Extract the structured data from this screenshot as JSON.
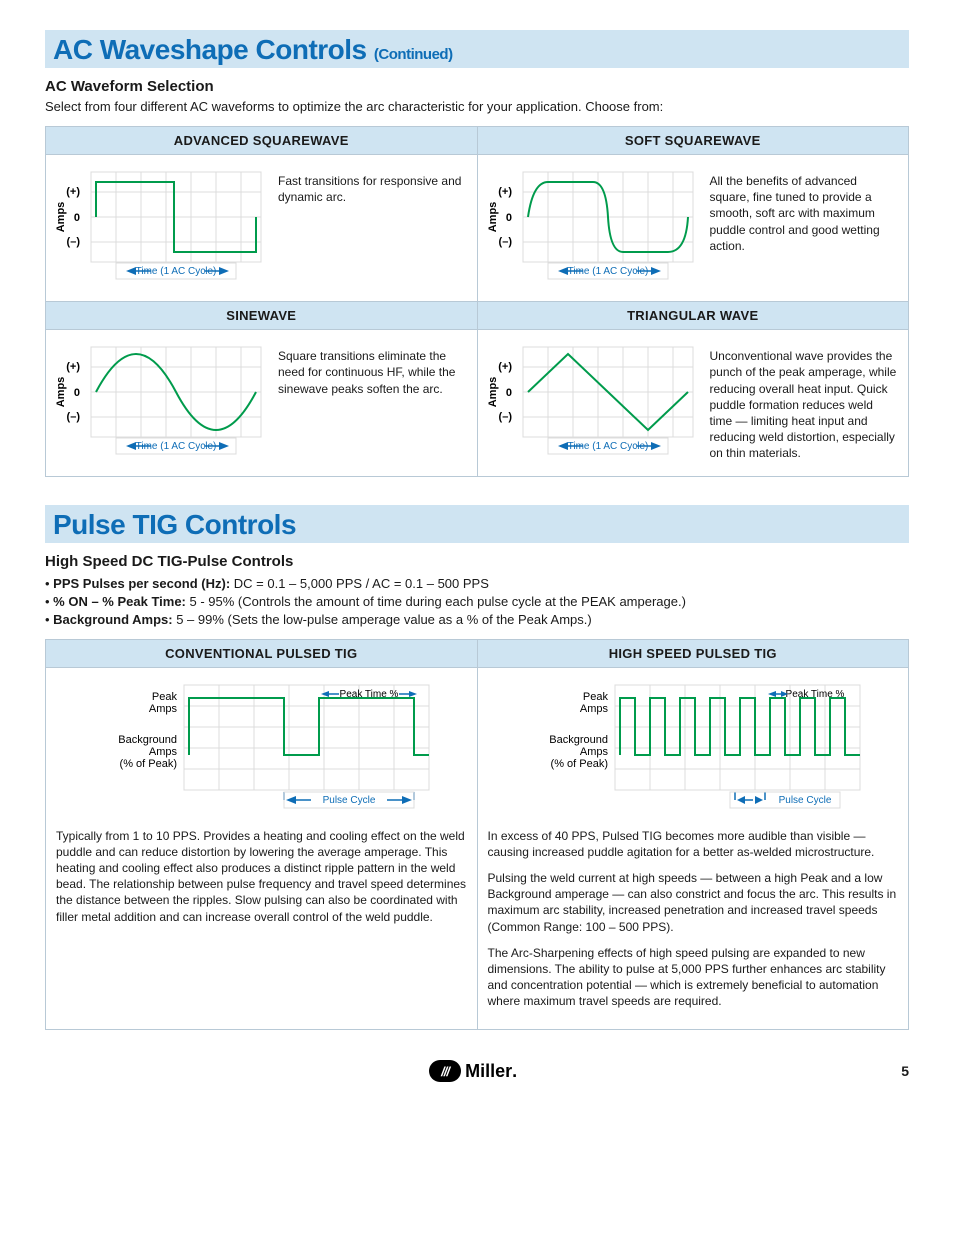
{
  "section1": {
    "title": "AC Waveshape Controls",
    "title_sub": "(Continued)",
    "heading": "AC Waveform Selection",
    "intro": "Select from four different AC waveforms to optimize the arc characteristic for your application. Choose from:",
    "waves": [
      {
        "header": "ADVANCED SQUAREWAVE",
        "y_axis": "Amps",
        "y_plus": "(+)",
        "y_zero": "0",
        "y_minus": "(–)",
        "x_axis": "Time (1 AC Cycle)",
        "desc": "Fast transitions for responsive and dynamic arc."
      },
      {
        "header": "SOFT SQUAREWAVE",
        "y_axis": "Amps",
        "y_plus": "(+)",
        "y_zero": "0",
        "y_minus": "(–)",
        "x_axis": "Time (1 AC Cycle)",
        "desc": "All the benefits of advanced square, fine tuned to provide a smooth, soft arc with maximum puddle control and good wetting action."
      },
      {
        "header": "SINEWAVE",
        "y_axis": "Amps",
        "y_plus": "(+)",
        "y_zero": "0",
        "y_minus": "(–)",
        "x_axis": "Time (1 AC Cycle)",
        "desc": "Square transitions eliminate the need for continuous HF, while the sinewave peaks soften the arc."
      },
      {
        "header": "TRIANGULAR WAVE",
        "y_axis": "Amps",
        "y_plus": "(+)",
        "y_zero": "0",
        "y_minus": "(–)",
        "x_axis": "Time (1 AC Cycle)",
        "desc": "Unconventional wave provides the punch of the peak amperage, while reducing overall heat input. Quick puddle formation reduces weld time — limiting heat input and reducing weld distortion, especially on thin materials."
      }
    ]
  },
  "section2": {
    "title": "Pulse TIG Controls",
    "heading": "High Speed DC TIG-Pulse Controls",
    "bullets": [
      {
        "label": "PPS Pulses per second (Hz):",
        "text": "  DC = 0.1 – 5,000 PPS / AC = 0.1 – 500 PPS"
      },
      {
        "label": "% ON – % Peak Time:",
        "text": "  5 - 95% (Controls the amount of time during each pulse cycle at the PEAK amperage.)"
      },
      {
        "label": "Background Amps:",
        "text": "  5 – 99% (Sets the low-pulse amperage value as a % of the Peak Amps.)"
      }
    ],
    "pulses": [
      {
        "header": "CONVENTIONAL PULSED TIG",
        "y_peak": "Peak\nAmps",
        "y_bg": "Background\nAmps\n(% of Peak)",
        "peak_time": "Peak Time %",
        "x_axis": "Pulse Cycle",
        "desc": [
          "Typically from 1 to 10 PPS. Provides a heating and cooling effect on the weld puddle and can reduce distortion by lowering the average amperage. This heating and cooling effect also produces a distinct ripple pattern in the weld bead. The relationship between pulse frequency and travel speed determines the distance between the ripples. Slow pulsing can also be coordinated with filler metal addition and can increase overall control of the weld puddle."
        ]
      },
      {
        "header": "HIGH SPEED PULSED TIG",
        "y_peak": "Peak\nAmps",
        "y_bg": "Background\nAmps\n(% of Peak)",
        "peak_time": "Peak Time %",
        "x_axis": "Pulse Cycle",
        "desc": [
          "In excess of 40 PPS, Pulsed TIG becomes more audible than visible — causing increased puddle agitation for a better as-welded microstructure.",
          "Pulsing the weld current at high speeds — between a high Peak and a low Background amperage — can also constrict and focus the arc. This results in maximum arc stability, increased penetration and increased travel speeds (Common Range: 100 – 500 PPS).",
          "The Arc-Sharpening effects of high speed pulsing are expanded to new dimensions. The ability to pulse at 5,000 PPS further enhances arc stability and concentration potential — which is extremely beneficial to automation where maximum travel speeds are required."
        ]
      }
    ]
  },
  "chart_data": [
    {
      "type": "line",
      "title": "Advanced Squarewave",
      "xlabel": "Time (1 AC Cycle)",
      "ylabel": "Amps",
      "yticks": [
        "(+)",
        "0",
        "(–)"
      ],
      "x": [
        0,
        0.05,
        0.5,
        0.55,
        1.0
      ],
      "y": [
        1,
        1,
        1,
        -1,
        -1,
        -1
      ],
      "shape": "square"
    },
    {
      "type": "line",
      "title": "Soft Squarewave",
      "xlabel": "Time (1 AC Cycle)",
      "ylabel": "Amps",
      "yticks": [
        "(+)",
        "0",
        "(–)"
      ],
      "x": [
        0,
        0.1,
        0.4,
        0.5,
        0.6,
        0.9,
        1.0
      ],
      "y": [
        0,
        1,
        1,
        0,
        -1,
        -1,
        0
      ],
      "shape": "soft-square"
    },
    {
      "type": "line",
      "title": "Sinewave",
      "xlabel": "Time (1 AC Cycle)",
      "ylabel": "Amps",
      "yticks": [
        "(+)",
        "0",
        "(–)"
      ],
      "x": [
        0,
        0.25,
        0.5,
        0.75,
        1.0
      ],
      "y": [
        0,
        1,
        0,
        -1,
        0
      ],
      "shape": "sine"
    },
    {
      "type": "line",
      "title": "Triangular Wave",
      "xlabel": "Time (1 AC Cycle)",
      "ylabel": "Amps",
      "yticks": [
        "(+)",
        "0",
        "(–)"
      ],
      "x": [
        0,
        0.25,
        0.5,
        0.75,
        1.0
      ],
      "y": [
        0,
        1,
        0,
        -1,
        0
      ],
      "shape": "triangle"
    },
    {
      "type": "line",
      "title": "Conventional Pulsed TIG",
      "xlabel": "Pulse Cycle",
      "ylabel": "Amps",
      "yticks": [
        "Peak Amps",
        "Background Amps (% of Peak)"
      ],
      "annotations": [
        "Peak Time %"
      ],
      "x": [
        0,
        0.05,
        0.5,
        0.55,
        1.0,
        1.05,
        1.5,
        1.55,
        2.0
      ],
      "y": [
        0.4,
        1,
        1,
        0.4,
        0.4,
        1,
        1,
        0.4,
        0.4
      ],
      "shape": "pulse-slow"
    },
    {
      "type": "line",
      "title": "High Speed Pulsed TIG",
      "xlabel": "Pulse Cycle",
      "ylabel": "Amps",
      "yticks": [
        "Peak Amps",
        "Background Amps (% of Peak)"
      ],
      "annotations": [
        "Peak Time %"
      ],
      "x": [
        0,
        0.02,
        0.12,
        0.14,
        0.25,
        0.27,
        0.37,
        0.39,
        0.5
      ],
      "y": [
        0.4,
        1,
        1,
        0.4,
        0.4,
        1,
        1,
        0.4,
        0.4
      ],
      "shape": "pulse-fast",
      "cycles": 8
    }
  ],
  "footer": {
    "brand": "Miller",
    "page": "5"
  }
}
